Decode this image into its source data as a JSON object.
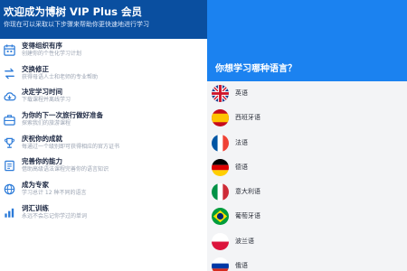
{
  "header": {
    "title": "欢迎成为博树 VIP Plus 会员",
    "subtitle": "你现在可以采取以下步骤来帮助你更快速地进行学习"
  },
  "features": [
    {
      "icon": "calendar-icon",
      "title": "变得组织有序",
      "desc": "创建你的个性化学习计划"
    },
    {
      "icon": "swap-icon",
      "title": "交换修正",
      "desc": "获得母语人士和老师的专业帮助"
    },
    {
      "icon": "cloud-icon",
      "title": "决定学习时间",
      "desc": "下载课程并离线学习"
    },
    {
      "icon": "suitcase-icon",
      "title": "为你的下一次旅行做好准备",
      "desc": "探索我们的旅游课程"
    },
    {
      "icon": "trophy-icon",
      "title": "庆祝你的成就",
      "desc": "每通过一个级别即可获得相应的官方证书"
    },
    {
      "icon": "book-icon",
      "title": "完善你的能力",
      "desc": "借助高级语法课程完善你的语言知识"
    },
    {
      "icon": "globe-icon",
      "title": "成为专家",
      "desc": "学习总计 12 种不同的语言"
    },
    {
      "icon": "chart-icon",
      "title": "词汇训练",
      "desc": "永远不会忘记你学过的单词"
    }
  ],
  "right": {
    "question": "你想学习哪种语言？",
    "languages": [
      {
        "flag": "uk-flag-icon",
        "name": "英语"
      },
      {
        "flag": "spain-flag-icon",
        "name": "西班牙语"
      },
      {
        "flag": "france-flag-icon",
        "name": "法语"
      },
      {
        "flag": "germany-flag-icon",
        "name": "德语"
      },
      {
        "flag": "italy-flag-icon",
        "name": "意大利语"
      },
      {
        "flag": "brazil-flag-icon",
        "name": "葡萄牙语"
      },
      {
        "flag": "poland-flag-icon",
        "name": "波兰语"
      },
      {
        "flag": "russia-flag-icon",
        "name": "俄语"
      }
    ]
  },
  "colors": {
    "header_bg": "#0a4fa0",
    "right_header_bg": "#1b82f0",
    "right_bg": "#f3f4f6",
    "icon_blue": "#2b7ad8"
  }
}
